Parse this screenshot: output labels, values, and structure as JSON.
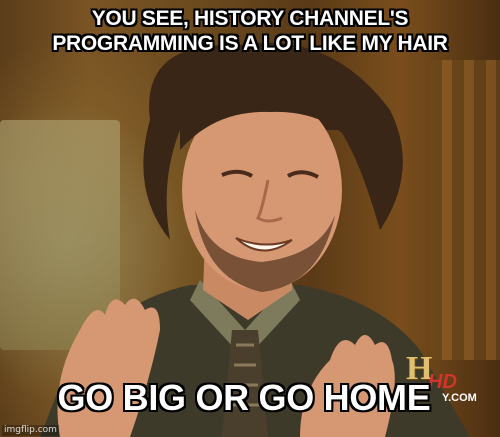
{
  "meme": {
    "top_text_line1": "YOU SEE, HISTORY CHANNEL'S",
    "top_text_line2": "PROGRAMMING IS A LOT LIKE MY HAIR",
    "bottom_text": "GO BIG OR GO HOME"
  },
  "channel_logo": {
    "letter": "H",
    "hd": "HD",
    "domain_fragment": "Y.COM"
  },
  "watermark": "imgflip.com",
  "colors": {
    "caption_fill": "#ffffff",
    "caption_stroke": "#000000",
    "logo_gold": "#e0c070",
    "logo_red": "#d1342a"
  }
}
